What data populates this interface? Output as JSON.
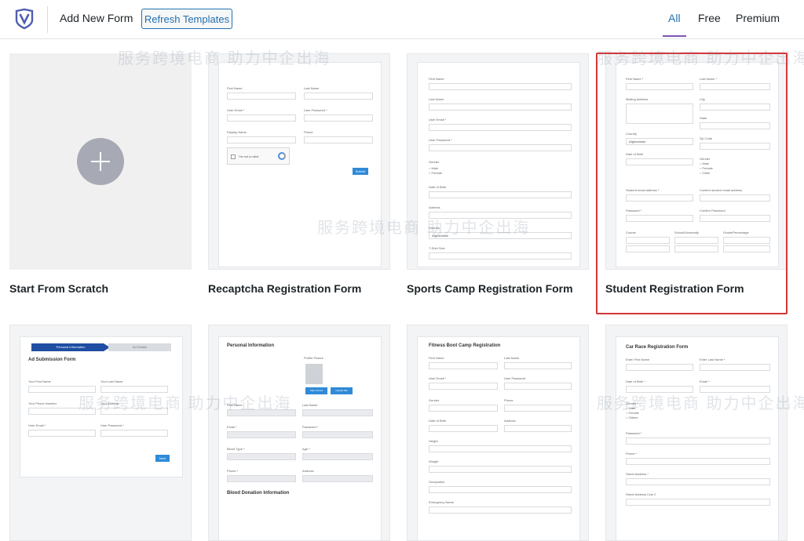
{
  "header": {
    "title": "Add New Form",
    "refresh_label": "Refresh Templates",
    "filters": [
      "All",
      "Free",
      "Premium"
    ],
    "active_filter": "All"
  },
  "cards": [
    {
      "label": "Start From Scratch"
    },
    {
      "label": "Recaptcha Registration Form"
    },
    {
      "label": "Sports Camp Registration Form"
    },
    {
      "label": "Student Registration Form"
    }
  ],
  "previews": {
    "recaptcha": {
      "fields": [
        "First Name",
        "Last Name",
        "User Email *",
        "User Password *",
        "Display Name",
        "Phone"
      ],
      "captcha": "I'm not a robot",
      "submit": "Submit"
    },
    "sports": {
      "fields": [
        "First Name",
        "Last Name",
        "User Email *",
        "User Password *",
        "Gender",
        "Date of Birth",
        "Address",
        "Country",
        "T-Shirt Size"
      ],
      "options": [
        "Male",
        "Female"
      ],
      "country": "Afghanistan"
    },
    "student": {
      "fields": [
        "First Name *",
        "Last Name *",
        "Mailing Address",
        "City",
        "State",
        "Country",
        "Zip Code",
        "Date of Birth",
        "Gender",
        "Student email address *",
        "Confirm student email address",
        "Password *",
        "Confirm Password",
        "Course",
        "School/University",
        "Grade/Percentage"
      ],
      "country": "Afghanistan",
      "options": [
        "Male",
        "Female",
        "Other"
      ]
    },
    "ad": {
      "steps": [
        "Personal Information",
        "Ad Details"
      ],
      "title": "Ad Submission Form",
      "fields": [
        "Your First Name",
        "Your Last Name",
        "Your Phone Number",
        "Your Address",
        "User Email *",
        "User Password *"
      ],
      "next": "Next"
    },
    "blood": {
      "title": "Personal Information",
      "profile": "Profile Picture",
      "buttons": [
        "Take Picture",
        "Upload File"
      ],
      "fields": [
        "First Name",
        "Last Name",
        "Email *",
        "Password *",
        "Blood Type *",
        "Age *",
        "Phone *",
        "Address"
      ],
      "footer": "Blood Donation Information"
    },
    "fitness": {
      "title": "Fitness Boot Camp Registration",
      "fields": [
        "First Name",
        "Last Name",
        "User Email *",
        "User Password",
        "Gender",
        "Phone",
        "Date of Birth",
        "Address",
        "Height",
        "Weight",
        "Occupation",
        "Emergency Name"
      ]
    },
    "carrace": {
      "title": "Car Race Registration Form",
      "fields": [
        "Enter First Name",
        "Enter Last Name *",
        "Date of Birth *",
        "Email *",
        "Gender *",
        "Password *",
        "Phone *",
        "Street Address *",
        "Street Address Line 2"
      ],
      "options": [
        "Male",
        "Female",
        "Others"
      ]
    }
  },
  "watermarks": [
    "服务跨境电商 助力中企出海"
  ]
}
